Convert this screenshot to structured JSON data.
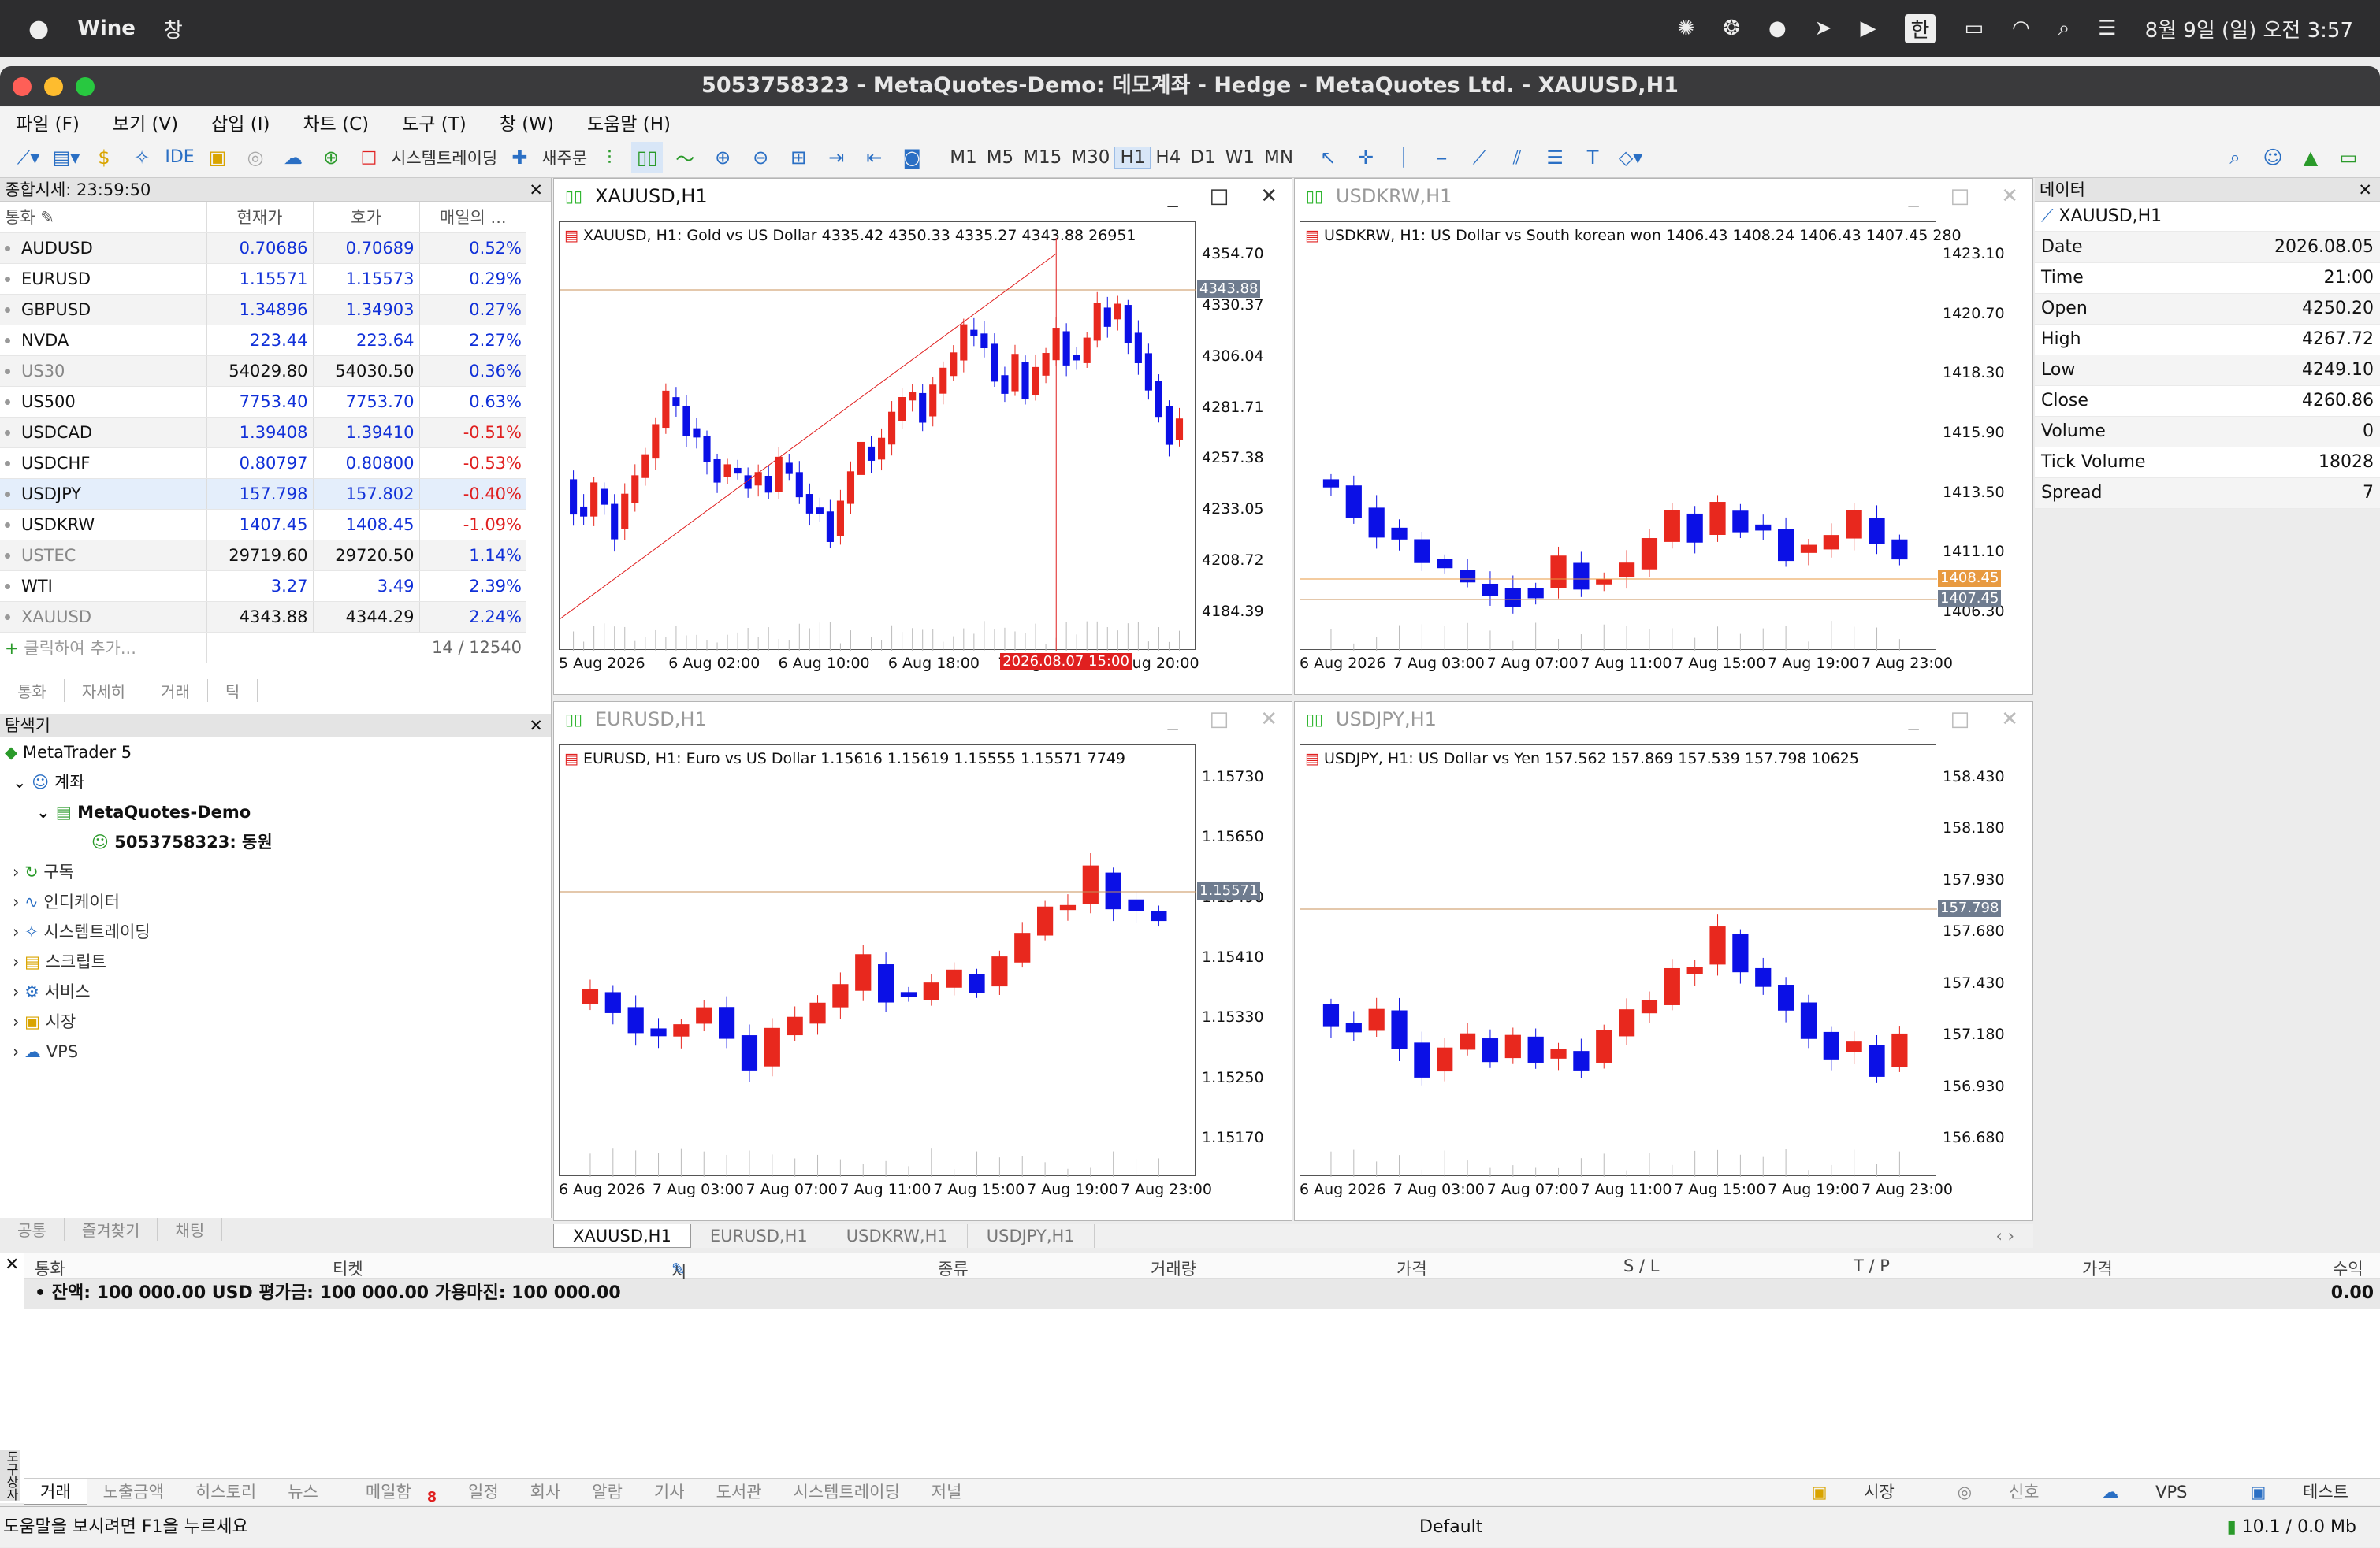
{
  "mac": {
    "app": "Wine",
    "menu": "창",
    "ime": "한",
    "datetime": "8월 9일 (일) 오전 3:57"
  },
  "window": {
    "title": "5053758323 - MetaQuotes-Demo: 데모계좌 - Hedge - MetaQuotes Ltd. - XAUUSD,H1"
  },
  "menu": [
    "파일 (F)",
    "보기 (V)",
    "삽입 (I)",
    "차트 (C)",
    "도구 (T)",
    "창 (W)",
    "도움말 (H)"
  ],
  "toolbar": {
    "ide": "IDE",
    "algo": "시스템트레이딩",
    "neworder": "새주문",
    "timeframes": [
      "M1",
      "M5",
      "M15",
      "M30",
      "H1",
      "H4",
      "D1",
      "W1",
      "MN"
    ],
    "active_tf": "H1"
  },
  "marketwatch": {
    "title": "종합시세: 23:59:50",
    "cols": [
      "통화",
      "현재가",
      "호가",
      "매일의 ..."
    ],
    "rows": [
      {
        "sym": "AUDUSD",
        "bid": "0.70686",
        "ask": "0.70689",
        "chg": "0.52%",
        "dir": "blue"
      },
      {
        "sym": "EURUSD",
        "bid": "1.15571",
        "ask": "1.15573",
        "chg": "0.29%",
        "dir": "blue"
      },
      {
        "sym": "GBPUSD",
        "bid": "1.34896",
        "ask": "1.34903",
        "chg": "0.27%",
        "dir": "blue"
      },
      {
        "sym": "NVDA",
        "bid": "223.44",
        "ask": "223.64",
        "chg": "2.27%",
        "dir": "blue"
      },
      {
        "sym": "US30",
        "bid": "54029.80",
        "ask": "54030.50",
        "chg": "0.36%",
        "dir": "dim"
      },
      {
        "sym": "US500",
        "bid": "7753.40",
        "ask": "7753.70",
        "chg": "0.63%",
        "dir": "blue"
      },
      {
        "sym": "USDCAD",
        "bid": "1.39408",
        "ask": "1.39410",
        "chg": "-0.51%",
        "dir": "blue"
      },
      {
        "sym": "USDCHF",
        "bid": "0.80797",
        "ask": "0.80800",
        "chg": "-0.53%",
        "dir": "blue"
      },
      {
        "sym": "USDJPY",
        "bid": "157.798",
        "ask": "157.802",
        "chg": "-0.40%",
        "dir": "blue"
      },
      {
        "sym": "USDKRW",
        "bid": "1407.45",
        "ask": "1408.45",
        "chg": "-1.09%",
        "dir": "blue"
      },
      {
        "sym": "USTEC",
        "bid": "29719.60",
        "ask": "29720.50",
        "chg": "1.14%",
        "dir": "dim"
      },
      {
        "sym": "WTI",
        "bid": "3.27",
        "ask": "3.49",
        "chg": "2.39%",
        "dir": "blue"
      },
      {
        "sym": "XAUUSD",
        "bid": "4343.88",
        "ask": "4344.29",
        "chg": "2.24%",
        "dir": "dim"
      }
    ],
    "add": "클릭하여 추가...",
    "count": "14 / 12540",
    "tabs": [
      "통화",
      "자세히",
      "거래",
      "틱"
    ]
  },
  "navigator": {
    "title": "탐색기",
    "root": "MetaTrader 5",
    "account": "계좌",
    "server": "MetaQuotes-Demo",
    "acc": "5053758323: 동원",
    "items": [
      "구독",
      "인디케이터",
      "시스템트레이딩",
      "스크립트",
      "서비스",
      "시장",
      "VPS"
    ],
    "tabs": [
      "공통",
      "즐겨찾기",
      "채팅"
    ]
  },
  "charts": [
    {
      "name": "XAUUSD,H1",
      "info": "XAUUSD, H1:  Gold vs US Dollar  4335.42 4350.33 4335.27 4343.88  26951",
      "prices": [
        "4354.70",
        "4330.37",
        "4306.04",
        "4281.71",
        "4257.38",
        "4233.05",
        "4208.72",
        "4184.39"
      ],
      "price_tag": "4343.88",
      "dates": [
        "5 Aug 2026",
        "6 Aug 02:00",
        "6 Aug 10:00",
        "6 Aug 18:00",
        "7 Aug 04:00",
        "7 Aug 20:00"
      ],
      "cursor": "2026.08.07 15:00"
    },
    {
      "name": "USDKRW,H1",
      "info": "USDKRW, H1:  US Dollar vs South korean won  1406.43 1408.24 1406.43 1407.45  280",
      "prices": [
        "1423.10",
        "1420.70",
        "1418.30",
        "1415.90",
        "1413.50",
        "1411.10",
        "1406.30"
      ],
      "ask_tag": "1408.45",
      "price_tag": "1407.45",
      "dates": [
        "6 Aug 2026",
        "7 Aug 03:00",
        "7 Aug 07:00",
        "7 Aug 11:00",
        "7 Aug 15:00",
        "7 Aug 19:00",
        "7 Aug 23:00"
      ]
    },
    {
      "name": "EURUSD,H1",
      "info": "EURUSD, H1:  Euro vs US Dollar  1.15616 1.15619 1.15555 1.15571  7749",
      "prices": [
        "1.15730",
        "1.15650",
        "1.15490",
        "1.15410",
        "1.15330",
        "1.15250",
        "1.15170"
      ],
      "price_tag": "1.15571",
      "dates": [
        "6 Aug 2026",
        "7 Aug 03:00",
        "7 Aug 07:00",
        "7 Aug 11:00",
        "7 Aug 15:00",
        "7 Aug 19:00",
        "7 Aug 23:00"
      ]
    },
    {
      "name": "USDJPY,H1",
      "info": "USDJPY, H1:  US Dollar vs Yen  157.562 157.869 157.539 157.798  10625",
      "prices": [
        "158.430",
        "158.180",
        "157.930",
        "157.680",
        "157.430",
        "157.180",
        "156.930",
        "156.680"
      ],
      "price_tag": "157.798",
      "dates": [
        "6 Aug 2026",
        "7 Aug 03:00",
        "7 Aug 07:00",
        "7 Aug 11:00",
        "7 Aug 15:00",
        "7 Aug 19:00",
        "7 Aug 23:00"
      ]
    }
  ],
  "chart_tabs": [
    "XAUUSD,H1",
    "EURUSD,H1",
    "USDKRW,H1",
    "USDJPY,H1"
  ],
  "datawindow": {
    "title": "데이터",
    "symbol": "XAUUSD,H1",
    "rows": [
      [
        "Date",
        "2026.08.05"
      ],
      [
        "Time",
        "21:00"
      ],
      [
        "Open",
        "4250.20"
      ],
      [
        "High",
        "4267.72"
      ],
      [
        "Low",
        "4249.10"
      ],
      [
        "Close",
        "4260.86"
      ],
      [
        "Volume",
        "0"
      ],
      [
        "Tick Volume",
        "18028"
      ],
      [
        "Spread",
        "7"
      ]
    ]
  },
  "toolbox": {
    "cols": [
      "통화",
      "티켓",
      "시간",
      "종류",
      "거래량",
      "가격",
      "S / L",
      "T / P",
      "가격",
      "수익"
    ],
    "balance": "잔액: 100 000.00 USD  평가금: 100 000.00  가용마진: 100 000.00",
    "profit": "0.00",
    "tabs": [
      "거래",
      "노출금액",
      "히스토리",
      "뉴스",
      "메일함",
      "일정",
      "회사",
      "알람",
      "기사",
      "도서관",
      "시스템트레이딩",
      "저널"
    ],
    "mail_badge": "8",
    "side": "도구상자",
    "market": "시장",
    "signals": "신호",
    "vps": "VPS",
    "test": "테스트"
  },
  "status": {
    "help": "도움말을 보시려면 F1을 누르세요",
    "profile": "Default",
    "conn": "10.1 / 0.0 Mb"
  },
  "colors": {
    "bull": "#e8281e",
    "bear": "#0b10e6",
    "accent": "#2a6fc4"
  }
}
